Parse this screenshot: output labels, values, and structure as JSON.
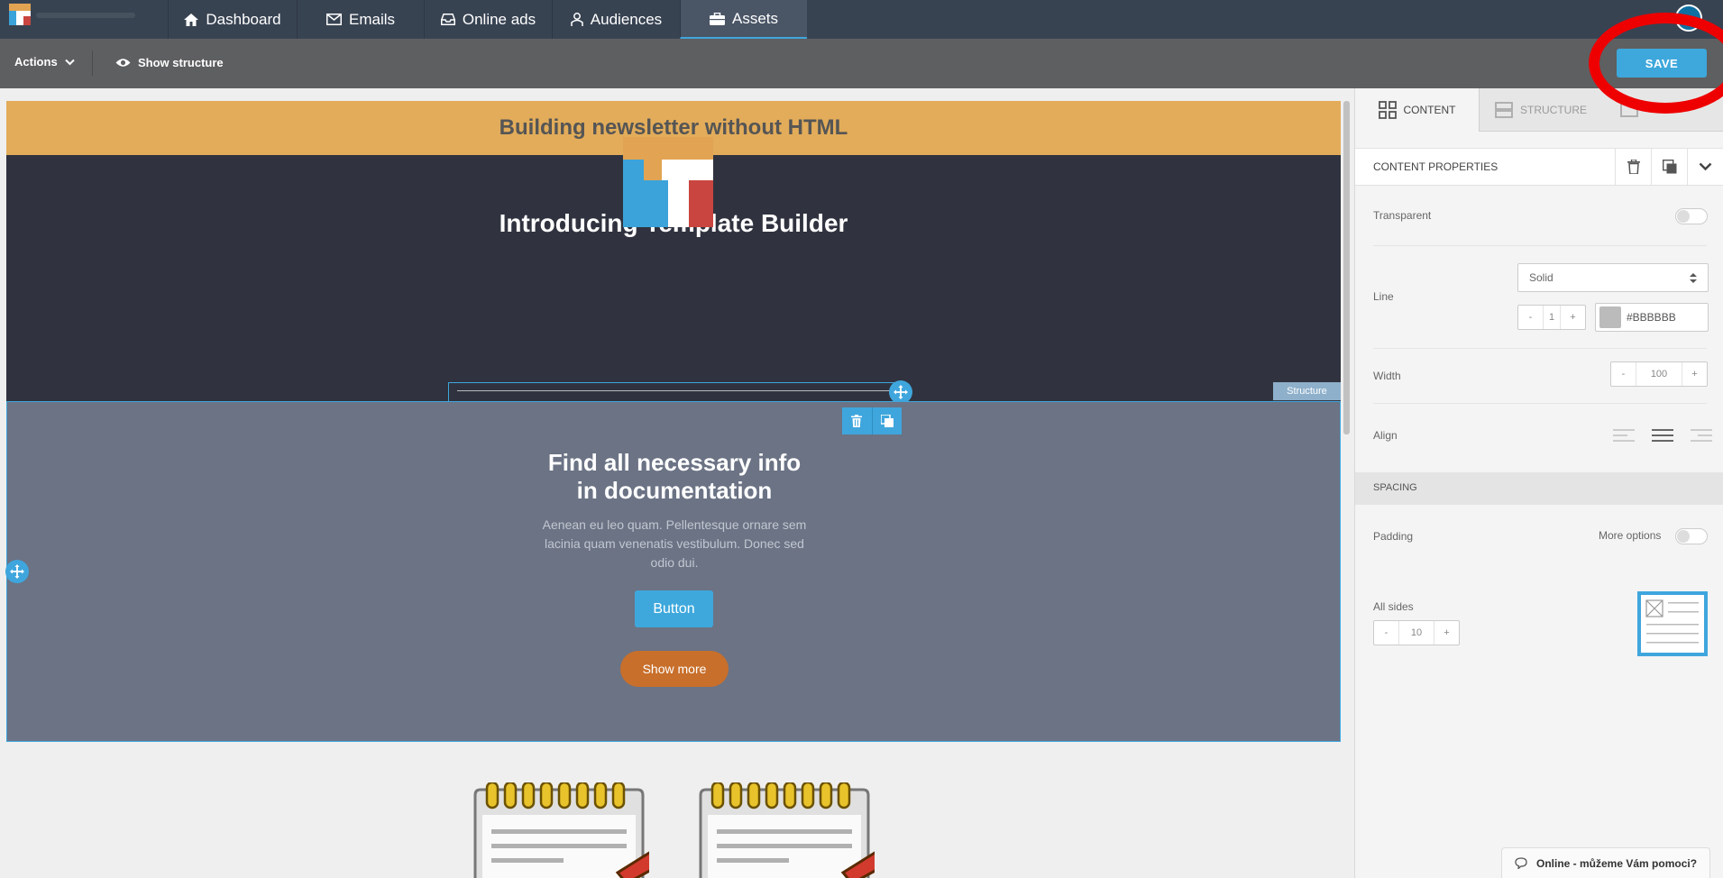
{
  "nav": {
    "tabs": [
      {
        "label": "Dashboard",
        "icon": "home-icon"
      },
      {
        "label": "Emails",
        "icon": "envelope-icon"
      },
      {
        "label": "Online ads",
        "icon": "inbox-icon"
      },
      {
        "label": "Audiences",
        "icon": "users-icon"
      },
      {
        "label": "Assets",
        "icon": "briefcase-icon"
      }
    ],
    "active_tab": "Assets"
  },
  "toolbar": {
    "actions_label": "Actions",
    "show_structure_label": "Show structure",
    "save_label": "SAVE"
  },
  "canvas": {
    "header_title": "Building newsletter without HTML",
    "hero_title": "Introducing Template Builder",
    "structure_tag": "Structure",
    "section_title": "Find all necessary info in documentation",
    "section_text": "Aenean eu leo quam. Pellentesque ornare sem lacinia quam venenatis vestibulum. Donec sed odio dui.",
    "button_label": "Button",
    "show_more_label": "Show more"
  },
  "panel": {
    "tabs": [
      {
        "label": "CONTENT",
        "active": true
      },
      {
        "label": "STRUCTURE",
        "active": false
      }
    ],
    "content_properties_title": "CONTENT PROPERTIES",
    "transparent_label": "Transparent",
    "line_label": "Line",
    "line_style": "Solid",
    "line_thickness": "1",
    "line_color": "#BBBBBB",
    "width_label": "Width",
    "width_value": "100",
    "align_label": "Align",
    "spacing_label": "SPACING",
    "padding_label": "Padding",
    "more_options_label": "More options",
    "all_sides_label": "All sides",
    "all_sides_value": "10"
  },
  "chat": {
    "label": "Online - můžeme Vám pomoci?"
  },
  "colors": {
    "accent": "#3ea8dc",
    "nav_bg": "#384352",
    "header_orange": "#e2ac5a",
    "dark_section": "#30333f",
    "mid_section": "#6b7385",
    "show_more": "#c86f2b",
    "line_swatch": "#BBBBBB"
  }
}
